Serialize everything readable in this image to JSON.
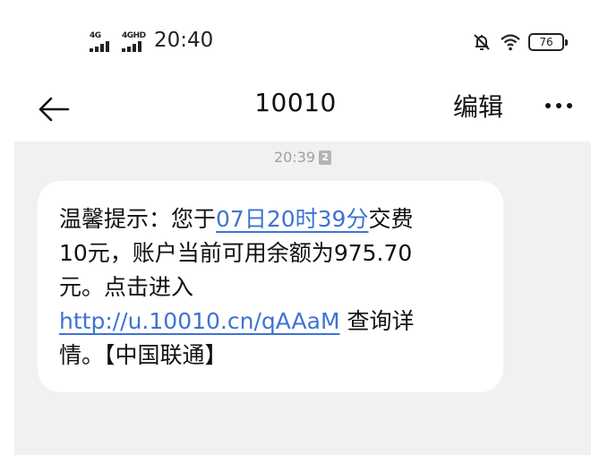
{
  "status_bar": {
    "network1": "4G",
    "network2": "4GHD",
    "time": "20:40",
    "battery": "76",
    "icons": [
      "signal-icon",
      "mute-bell-icon",
      "wifi-icon",
      "battery-icon"
    ]
  },
  "header": {
    "title": "10010",
    "edit_label": "编辑",
    "back_icon": "back-arrow-icon",
    "more_icon": "more-icon"
  },
  "conversation": {
    "message": {
      "time": "20:39",
      "sim": "2",
      "text_part1": "温馨提示：您于",
      "date_link": "07日20时39分",
      "text_part2": "交费",
      "text_line2": "10元，账户当前可用余额为975.70",
      "text_line3": "元。点击进入",
      "url_link": "http://u.10010.cn/qAAaM",
      "text_part4": " 查询详",
      "text_line5": "情。【中国联通】"
    }
  },
  "colors": {
    "link": "#3e73d3",
    "conversation_bg": "#f1f1f3",
    "bubble_bg": "#ffffff",
    "timestamp": "#a0a0a0"
  }
}
